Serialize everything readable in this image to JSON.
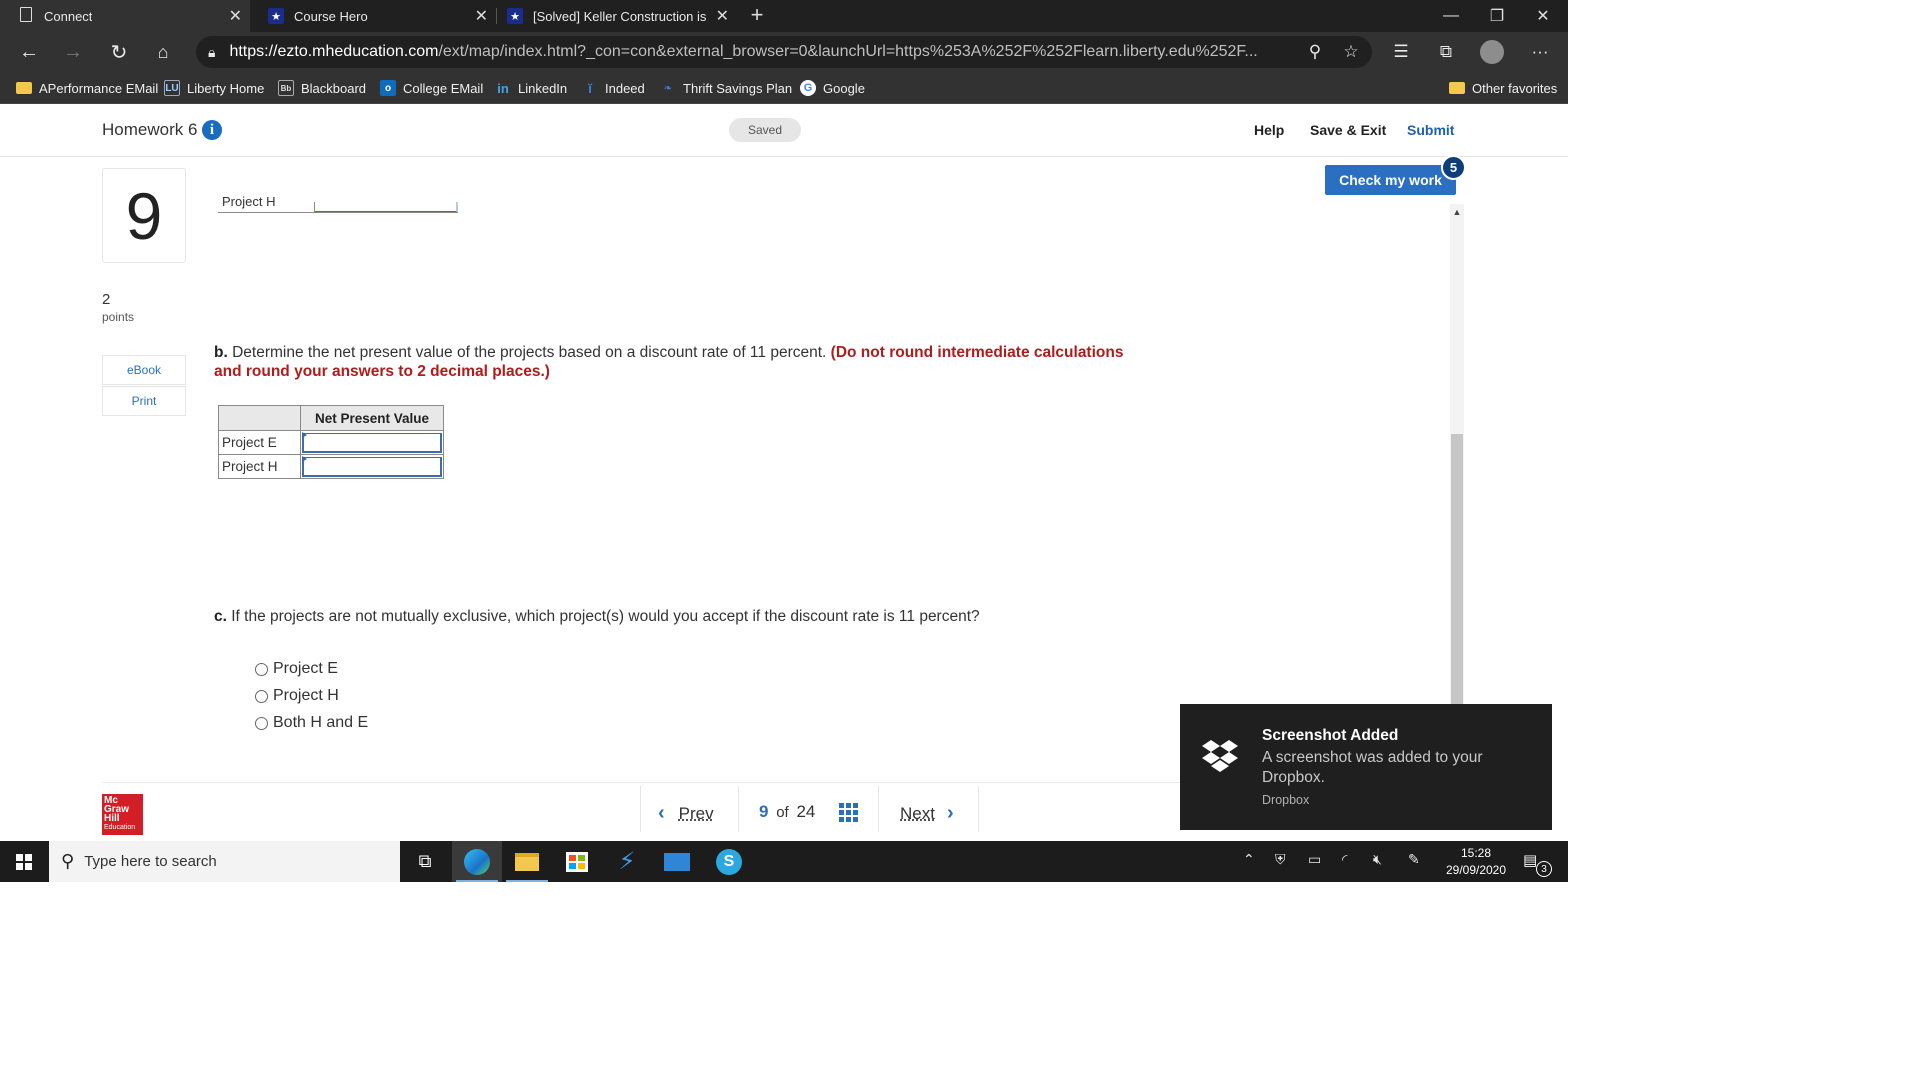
{
  "browser": {
    "tabs": [
      {
        "title": "Connect",
        "icon": "page-icon",
        "active": true
      },
      {
        "title": "Course Hero",
        "icon": "star-icon",
        "active": false
      },
      {
        "title": "[Solved] Keller Construction is co",
        "icon": "star-icon",
        "active": false
      }
    ],
    "url_host": "https://ezto.mheducation.com",
    "url_path": "/ext/map/index.html?_con=con&external_browser=0&launchUrl=https%253A%252F%252Flearn.liberty.edu%252F...",
    "favorites": [
      {
        "label": "APerformance EMail",
        "icon": "folder-icon"
      },
      {
        "label": "Liberty Home",
        "icon": "liberty-icon"
      },
      {
        "label": "Blackboard",
        "icon": "blackboard-icon"
      },
      {
        "label": "College EMail",
        "icon": "outlook-icon"
      },
      {
        "label": "LinkedIn",
        "icon": "linkedin-icon"
      },
      {
        "label": "Indeed",
        "icon": "indeed-icon"
      },
      {
        "label": "Thrift Savings Plan",
        "icon": "tsp-icon"
      },
      {
        "label": "Google",
        "icon": "google-icon"
      }
    ],
    "other_favorites": "Other favorites"
  },
  "header": {
    "title": "Homework 6",
    "saved": "Saved",
    "help": "Help",
    "save_exit": "Save & Exit",
    "submit": "Submit"
  },
  "question": {
    "number": "9",
    "points": "2",
    "points_label": "points",
    "ebook": "eBook",
    "print": "Print",
    "check_work": "Check my work",
    "check_badge": "5",
    "partial_row_label": "Project H",
    "part_b_letter": "b.",
    "part_b_text": "Determine the net present value of the projects based on a discount rate of 11 percent.",
    "part_b_note_1": "(Do not round intermediate calculations",
    "part_b_note_2": "and round your answers to 2 decimal places.)",
    "table": {
      "header": "Net Present Value",
      "rows": [
        "Project E",
        "Project H"
      ]
    },
    "part_c_letter": "c.",
    "part_c_text": "If the projects are not mutually exclusive, which project(s) would you accept if the discount rate is 11 percent?",
    "options": [
      "Project E",
      "Project H",
      "Both H and E"
    ]
  },
  "footer": {
    "logo_line1": "Mc",
    "logo_line2": "Graw",
    "logo_line3": "Hill",
    "logo_line4": "Education",
    "prev": "Prev",
    "current": "9",
    "of": "of",
    "total": "24",
    "next": "Next"
  },
  "toast": {
    "title": "Screenshot Added",
    "body": "A screenshot was added to your Dropbox.",
    "source": "Dropbox"
  },
  "taskbar": {
    "search_placeholder": "Type here to search",
    "time": "15:28",
    "date": "29/09/2020",
    "notifications": "3"
  }
}
